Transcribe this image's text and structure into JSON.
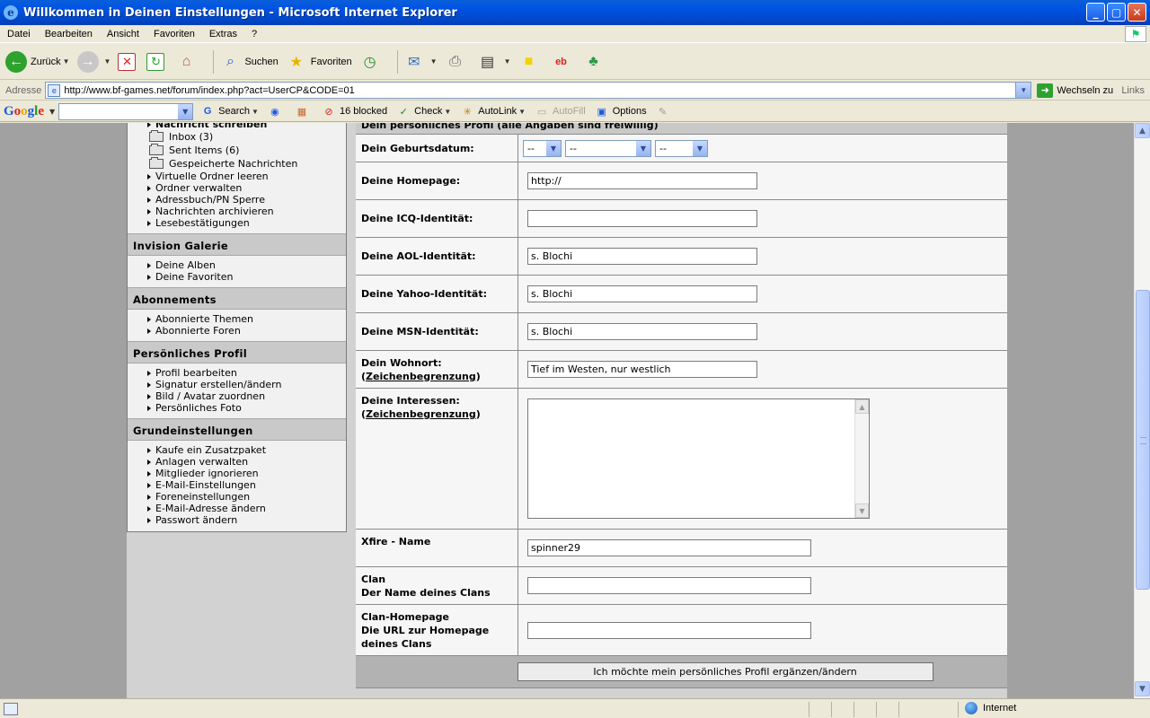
{
  "window": {
    "title": "Willkommen in Deinen Einstellungen - Microsoft Internet Explorer"
  },
  "menu": [
    "Datei",
    "Bearbeiten",
    "Ansicht",
    "Favoriten",
    "Extras",
    "?"
  ],
  "toolbar": {
    "back": "Zurück",
    "search": "Suchen",
    "favorites": "Favoriten"
  },
  "address": {
    "label": "Adresse",
    "url": "http://www.bf-games.net/forum/index.php?act=UserCP&CODE=01",
    "go": "Wechseln zu",
    "links": "Links"
  },
  "google": {
    "search": "Search",
    "blocked": "16 blocked",
    "check": "Check",
    "autolink": "AutoLink",
    "autofill": "AutoFill",
    "options": "Options"
  },
  "sidebar": {
    "top_item": "Nachricht schreiben",
    "folders": [
      "Inbox (3)",
      "Sent Items (6)",
      "Gespeicherte Nachrichten"
    ],
    "messenger_links": [
      "Virtuelle Ordner leeren",
      "Ordner verwalten",
      "Adressbuch/PN Sperre",
      "Nachrichten archivieren",
      "Lesebestätigungen"
    ],
    "sections": [
      {
        "title": "Invision Galerie",
        "items": [
          "Deine Alben",
          "Deine Favoriten"
        ]
      },
      {
        "title": "Abonnements",
        "items": [
          "Abonnierte Themen",
          "Abonnierte Foren"
        ]
      },
      {
        "title": "Persönliches Profil",
        "items": [
          "Profil bearbeiten",
          "Signatur erstellen/ändern",
          "Bild / Avatar zuordnen",
          "Persönliches Foto"
        ]
      },
      {
        "title": "Grundeinstellungen",
        "items": [
          "Kaufe ein Zusatzpaket",
          "Anlagen verwalten",
          "Mitglieder ignorieren",
          "E-Mail-Einstellungen",
          "Foreneinstellungen",
          "E-Mail-Adresse ändern",
          "Passwort ändern"
        ]
      }
    ]
  },
  "form": {
    "header": "Dein persönliches Profil (alle Angaben sind freiwillig)",
    "birthday": {
      "label": "Dein Geburtsdatum:",
      "day": "--",
      "month": "--",
      "year": "--"
    },
    "homepage": {
      "label": "Deine Homepage:",
      "value": "http://"
    },
    "icq": {
      "label": "Deine ICQ-Identität:",
      "value": ""
    },
    "aol": {
      "label": "Deine AOL-Identität:",
      "value": "s. Blochi"
    },
    "yahoo": {
      "label": "Deine Yahoo-Identität:",
      "value": "s. Blochi"
    },
    "msn": {
      "label": "Deine MSN-Identität:",
      "value": "s. Blochi"
    },
    "location": {
      "label": "Dein Wohnort:",
      "limit_link": "Zeichenbegrenzung",
      "value": "Tief im Westen, nur westlich"
    },
    "interests": {
      "label": "Deine Interessen:",
      "limit_link": "Zeichenbegrenzung",
      "value": ""
    },
    "xfire": {
      "label": "Xfire - Name",
      "value": "spinner29"
    },
    "clan": {
      "label": "Clan",
      "sublabel": "Der Name deines Clans",
      "value": ""
    },
    "clan_homepage": {
      "label": "Clan-Homepage",
      "sublabel1": "Die URL zur Homepage",
      "sublabel2": "deines Clans",
      "value": ""
    },
    "submit": "Ich möchte mein persönliches Profil ergänzen/ändern"
  },
  "status": {
    "zone": "Internet"
  }
}
